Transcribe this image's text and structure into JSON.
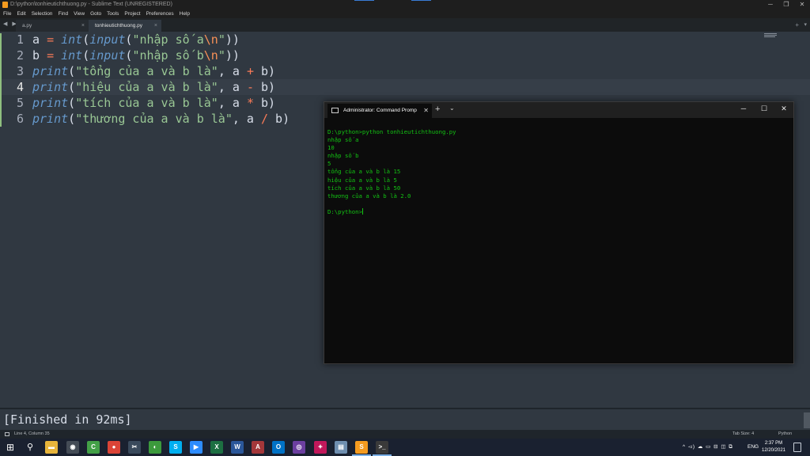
{
  "window": {
    "title": "D:\\python\\tonhieutichthuong.py - Sublime Text (UNREGISTERED)",
    "minimize": "─",
    "maximize": "❐",
    "close": "✕"
  },
  "menu": [
    "File",
    "Edit",
    "Selection",
    "Find",
    "View",
    "Goto",
    "Tools",
    "Project",
    "Preferences",
    "Help"
  ],
  "tabs": {
    "nav": "◀ ▶",
    "items": [
      {
        "label": "a.py",
        "close": "×"
      },
      {
        "label": "tonhieutichthuong.py",
        "close": "×"
      }
    ],
    "add": "+",
    "dropdown": "▾"
  },
  "editor": {
    "line_numbers": [
      "1",
      "2",
      "3",
      "4",
      "5",
      "6"
    ],
    "current_line": 4,
    "lines": [
      [
        {
          "t": "a ",
          "c": "pn"
        },
        {
          "t": "=",
          "c": "op"
        },
        {
          "t": " ",
          "c": "pn"
        },
        {
          "t": "int",
          "c": "fn"
        },
        {
          "t": "(",
          "c": "pn"
        },
        {
          "t": "input",
          "c": "fn"
        },
        {
          "t": "(",
          "c": "pn"
        },
        {
          "t": "\"nhập số a",
          "c": "str"
        },
        {
          "t": "\\n",
          "c": "esc"
        },
        {
          "t": "\"",
          "c": "str"
        },
        {
          "t": "))",
          "c": "pn"
        }
      ],
      [
        {
          "t": "b ",
          "c": "pn"
        },
        {
          "t": "=",
          "c": "op"
        },
        {
          "t": " ",
          "c": "pn"
        },
        {
          "t": "int",
          "c": "fn"
        },
        {
          "t": "(",
          "c": "pn"
        },
        {
          "t": "input",
          "c": "fn"
        },
        {
          "t": "(",
          "c": "pn"
        },
        {
          "t": "\"nhập số b",
          "c": "str"
        },
        {
          "t": "\\n",
          "c": "esc"
        },
        {
          "t": "\"",
          "c": "str"
        },
        {
          "t": "))",
          "c": "pn"
        }
      ],
      [
        {
          "t": "print",
          "c": "fn"
        },
        {
          "t": "(",
          "c": "pn"
        },
        {
          "t": "\"tổng của a và b là\"",
          "c": "str"
        },
        {
          "t": ", a ",
          "c": "pn"
        },
        {
          "t": "+",
          "c": "op"
        },
        {
          "t": " b)",
          "c": "pn"
        }
      ],
      [
        {
          "t": "print",
          "c": "fn"
        },
        {
          "t": "(",
          "c": "pn"
        },
        {
          "t": "\"hiệu của a và b là\"",
          "c": "str"
        },
        {
          "t": ", a ",
          "c": "pn"
        },
        {
          "t": "-",
          "c": "op"
        },
        {
          "t": " b)",
          "c": "pn"
        }
      ],
      [
        {
          "t": "print",
          "c": "fn"
        },
        {
          "t": "(",
          "c": "pn"
        },
        {
          "t": "\"tích của a và b là\"",
          "c": "str"
        },
        {
          "t": ", a ",
          "c": "pn"
        },
        {
          "t": "*",
          "c": "op"
        },
        {
          "t": " b)",
          "c": "pn"
        }
      ],
      [
        {
          "t": "print",
          "c": "fn"
        },
        {
          "t": "(",
          "c": "pn"
        },
        {
          "t": "\"thương của a và b là\"",
          "c": "str"
        },
        {
          "t": ", a ",
          "c": "pn"
        },
        {
          "t": "/",
          "c": "op"
        },
        {
          "t": " b)",
          "c": "pn"
        }
      ]
    ]
  },
  "build_output": "[Finished in 92ms]",
  "status": {
    "position": "Line 4, Column 35",
    "tab_size": "Tab Size: 4",
    "syntax": "Python"
  },
  "cmd": {
    "tab_title": "Administrator: Command Promp",
    "tab_close": "✕",
    "new_tab": "+",
    "dropdown": "⌄",
    "minimize": "─",
    "maximize": "☐",
    "close": "✕",
    "output": "D:\\python>python tonhieutichthuong.py\nnhập số a\n10\nnhập số b\n5\ntổng của a và b là 15\nhiệu của a và b là 5\ntích của a và b là 50\nthương của a và b là 2.0\n\nD:\\python>"
  },
  "taskbar": {
    "start": "⊞",
    "search": "⚲",
    "icons": [
      {
        "name": "file-explorer-icon",
        "glyph": "▬",
        "bg": "#e8b53b"
      },
      {
        "name": "github-desktop-icon",
        "glyph": "◉",
        "bg": "#444c56"
      },
      {
        "name": "camtasia-icon",
        "glyph": "C",
        "bg": "#43a047"
      },
      {
        "name": "chrome-icon",
        "glyph": "●",
        "bg": "#db4437"
      },
      {
        "name": "snipping-tool-icon",
        "glyph": "✂",
        "bg": "#3a4a5c"
      },
      {
        "name": "greenshot-icon",
        "glyph": "◐",
        "bg": "#3c9a3c"
      },
      {
        "name": "skype-icon",
        "glyph": "S",
        "bg": "#00aff0"
      },
      {
        "name": "zoom-icon",
        "glyph": "▶",
        "bg": "#2d8cff"
      },
      {
        "name": "excel-icon",
        "glyph": "X",
        "bg": "#1d6f42"
      },
      {
        "name": "word-icon",
        "glyph": "W",
        "bg": "#2b579a"
      },
      {
        "name": "access-icon",
        "glyph": "A",
        "bg": "#a4373a"
      },
      {
        "name": "outlook-icon",
        "glyph": "O",
        "bg": "#0072c6"
      },
      {
        "name": "obs-icon",
        "glyph": "◎",
        "bg": "#6c3fa0"
      },
      {
        "name": "tool-icon",
        "glyph": "✦",
        "bg": "#c2185b"
      },
      {
        "name": "notes-icon",
        "glyph": "▤",
        "bg": "#6f8fb0"
      },
      {
        "name": "sublime-text-icon",
        "glyph": "S",
        "bg": "#f59b1f"
      },
      {
        "name": "terminal-icon",
        "glyph": ">_",
        "bg": "#3a3a3a"
      }
    ],
    "tray": "^  ◅)  ☁  ▭  ⊟  ◫  ⧉",
    "lang": "ENG",
    "time": "2:37 PM",
    "date": "12/20/2021"
  },
  "colors": {
    "editor_bg": "#303841",
    "cmd_text": "#13c313",
    "accent": "#f59b1f"
  }
}
